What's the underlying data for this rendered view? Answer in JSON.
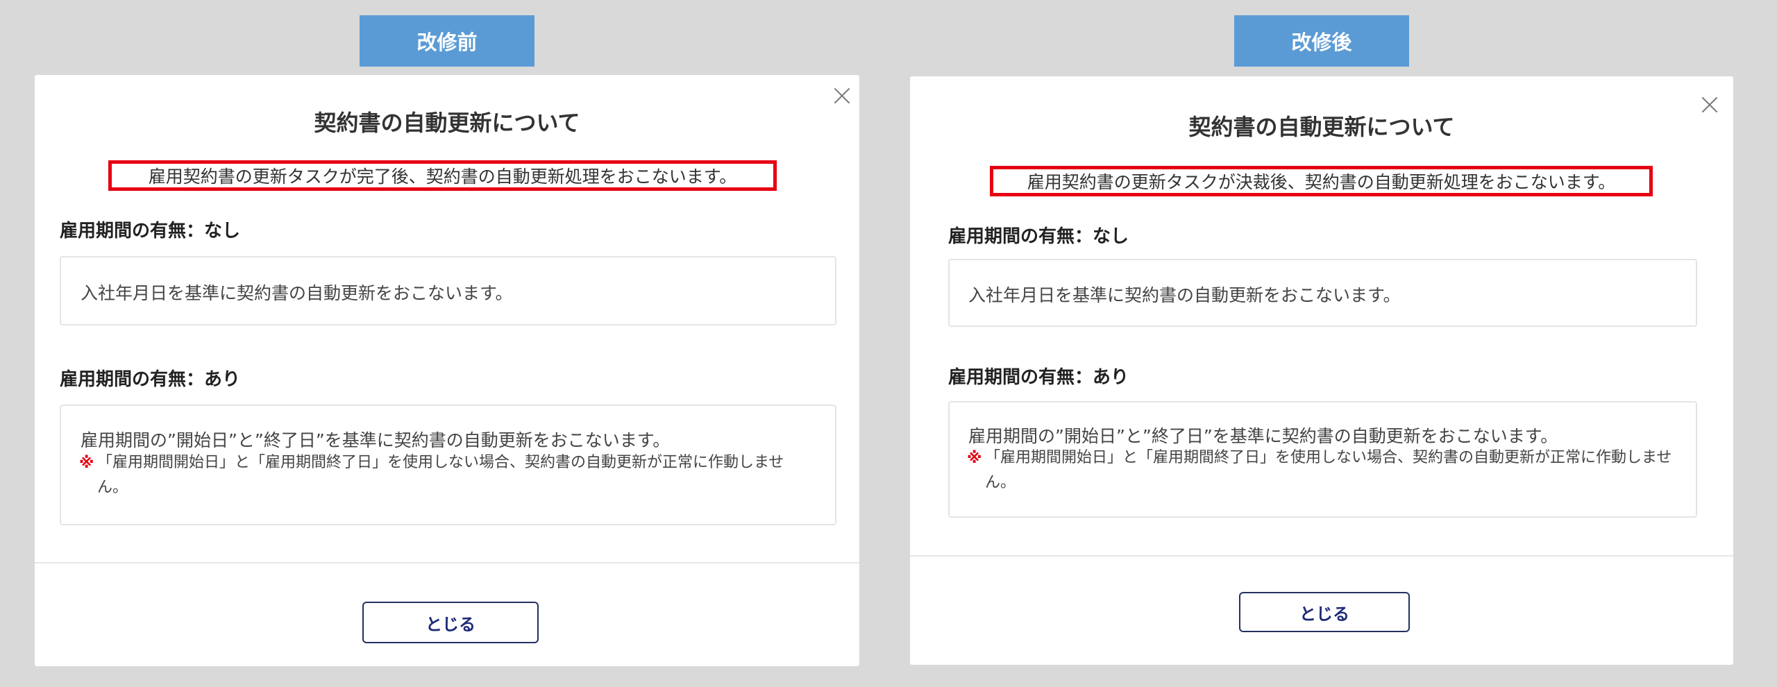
{
  "panels": [
    {
      "tag": "改修前",
      "title": "契約書の自動更新について",
      "notice": "雇用契約書の更新タスクが完了後、契約書の自動更新処理をおこないます。",
      "section_none_label": "雇用期間の有無：なし",
      "section_none_text": "入社年月日を基準に契約書の自動更新をおこないます。",
      "section_some_label": "雇用期間の有無：あり",
      "section_some_text": "雇用期間の”開始日”と”終了日”を基準に契約書の自動更新をおこないます。",
      "note_mark": "※",
      "note_text": "「雇用期間開始日」と「雇用期間終了日」を使用しない場合、契約書の自動更新が正常に作動しません。",
      "close_button": "とじる"
    },
    {
      "tag": "改修後",
      "title": "契約書の自動更新について",
      "notice": "雇用契約書の更新タスクが決裁後、契約書の自動更新処理をおこないます。",
      "section_none_label": "雇用期間の有無：なし",
      "section_none_text": "入社年月日を基準に契約書の自動更新をおこないます。",
      "section_some_label": "雇用期間の有無：あり",
      "section_some_text": "雇用期間の”開始日”と”終了日”を基準に契約書の自動更新をおこないます。",
      "note_mark": "※",
      "note_text": "「雇用期間開始日」と「雇用期間終了日」を使用しない場合、契約書の自動更新が正常に作動しません。",
      "close_button": "とじる"
    }
  ],
  "colors": {
    "background": "#d9d9d9",
    "tag": "#5b9bd5",
    "highlight": "#e60012",
    "button_border": "#24305e"
  }
}
